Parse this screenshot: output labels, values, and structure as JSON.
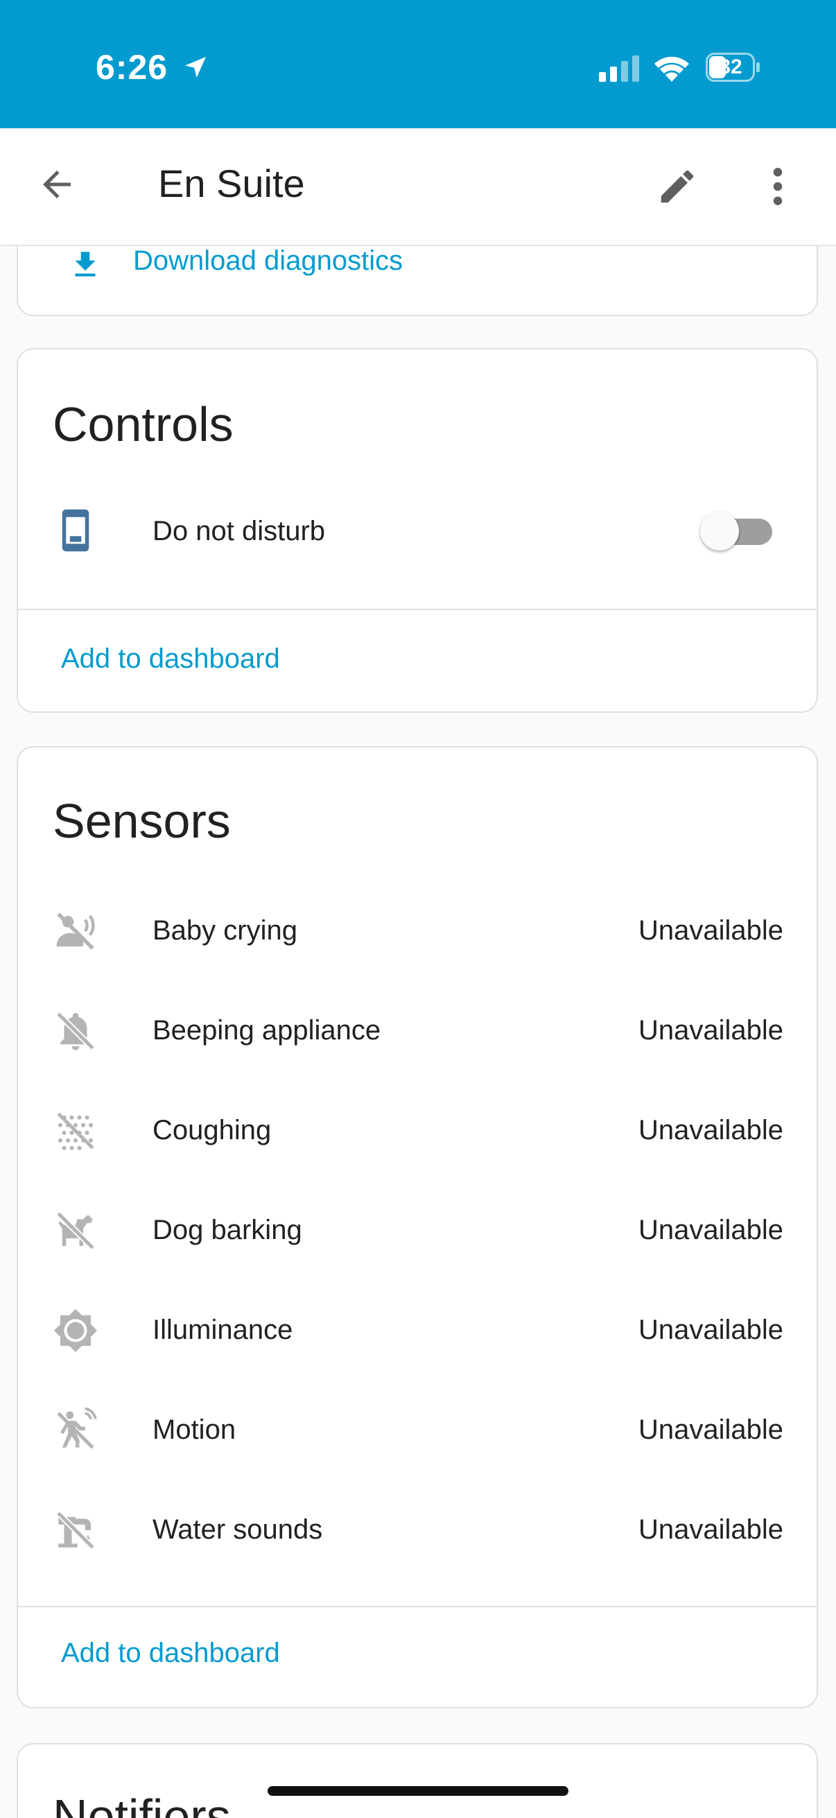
{
  "status_bar": {
    "time": "6:26",
    "battery": "32",
    "background": "#039bcf"
  },
  "app_bar": {
    "title": "En Suite",
    "back_icon": "arrow-left-icon",
    "edit_icon": "pencil-icon",
    "more_icon": "dots-vertical-icon"
  },
  "top_card": {
    "download_label": "Download diagnostics",
    "download_icon": "download-icon"
  },
  "controls": {
    "title": "Controls",
    "items": [
      {
        "label": "Do not disturb",
        "icon": "cellphone-icon",
        "state": "off"
      }
    ],
    "action": "Add to dashboard"
  },
  "sensors": {
    "title": "Sensors",
    "items": [
      {
        "label": "Baby crying",
        "value": "Unavailable",
        "icon": "baby-crying-off-icon"
      },
      {
        "label": "Beeping appliance",
        "value": "Unavailable",
        "icon": "bell-off-icon"
      },
      {
        "label": "Coughing",
        "value": "Unavailable",
        "icon": "coughing-off-icon"
      },
      {
        "label": "Dog barking",
        "value": "Unavailable",
        "icon": "dog-off-icon"
      },
      {
        "label": "Illuminance",
        "value": "Unavailable",
        "icon": "brightness-icon"
      },
      {
        "label": "Motion",
        "value": "Unavailable",
        "icon": "motion-off-icon"
      },
      {
        "label": "Water sounds",
        "value": "Unavailable",
        "icon": "water-pump-off-icon"
      }
    ],
    "action": "Add to dashboard"
  },
  "notifiers": {
    "title": "Notifiers"
  },
  "colors": {
    "accent": "#039bcf",
    "icon_gray": "#b4b4b4",
    "control_icon": "#44739e"
  }
}
